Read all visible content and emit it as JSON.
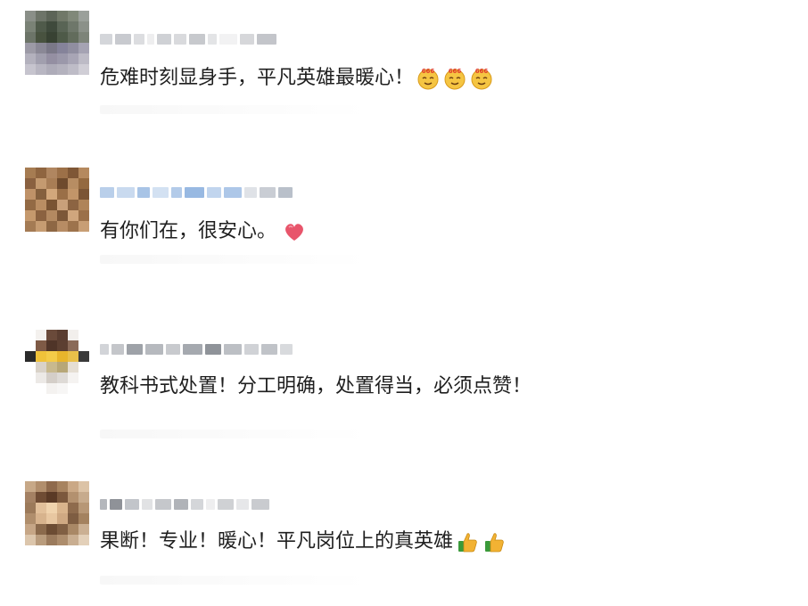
{
  "comments": [
    {
      "text": "危难时刻显身手，平凡英雄最暖心！",
      "emoji": [
        "666-face-icon",
        "666-face-icon",
        "666-face-icon"
      ]
    },
    {
      "text": "有你们在，很安心。",
      "emoji": [
        "heart-icon"
      ]
    },
    {
      "text": "教科书式处置！分工明确，处置得当，必须点赞！",
      "emoji": []
    },
    {
      "text": "果断！专业！暖心！平凡岗位上的真英雄",
      "emoji": [
        "thumbs-up-icon",
        "thumbs-up-icon"
      ]
    }
  ],
  "colors": {
    "text": "#1f1f1f",
    "emoji_face": "#f5c542",
    "heart": "#e8556b",
    "thumb": "#f2b233",
    "cuff": "#3a9a3a"
  }
}
